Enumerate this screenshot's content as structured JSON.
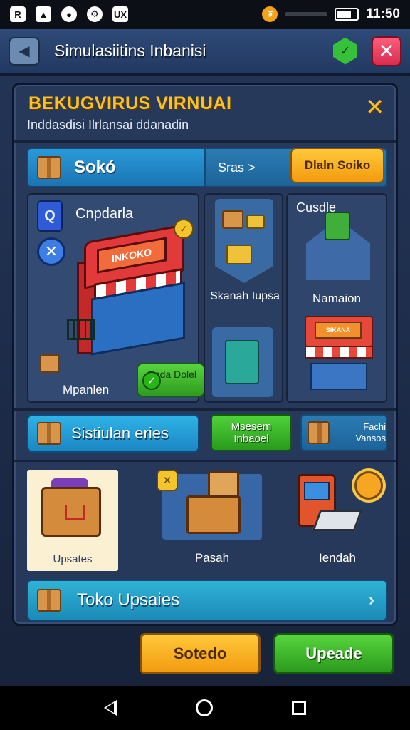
{
  "status_bar": {
    "icons": [
      "R",
      "▲",
      "●",
      "⚙",
      "UX"
    ],
    "coin_symbol": "₮",
    "time": "11:50"
  },
  "header": {
    "title": "Simulasiitins Inbanisi",
    "close_label": "✕"
  },
  "modal": {
    "title": "BEKUGVIRUS VIRNUAI",
    "subtitle": "Inddasdisi Ilrlansai ddanadin",
    "close_label": "✕",
    "store_tab": "Sokó",
    "sras_label": "Sras >",
    "open_store_button": "Dlaln Soiko",
    "shop_panel": {
      "label": "Cnpdarla",
      "sign": "INKOKO",
      "footer": "Mpanlen",
      "pay_button": "Pada Dolel"
    },
    "mid_column": {
      "label": "Skanah Iupsa"
    },
    "right_column": {
      "top_label": "Cusdle",
      "mid_label": "Namaion",
      "sign": "SIKANA"
    },
    "simulation_bar": "Sistiulan eries",
    "green_button": "Msesem Inbaoel",
    "vans_label": "Fachi Vansos",
    "items": [
      {
        "label": "Upsates",
        "selected": true
      },
      {
        "label": "Pasah",
        "selected": false
      },
      {
        "label": "Iendah",
        "selected": false
      }
    ],
    "upsales_bar": "Toko Upsaies"
  },
  "buttons": {
    "left": "Sotedo",
    "right": "Upeade"
  },
  "colors": {
    "accent_yellow": "#f6c12a",
    "panel_bg": "#27395a",
    "button_green": "#3fb82a",
    "button_orange": "#f5a623",
    "close_red": "#e23a55"
  }
}
